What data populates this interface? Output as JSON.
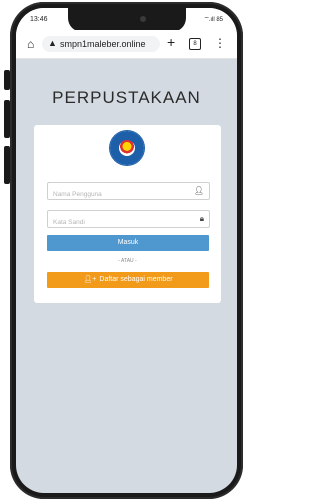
{
  "status": {
    "time": "13:46",
    "right": "Ⲻ.ıll 85"
  },
  "browser": {
    "url": "smpn1maleber.online",
    "tab_count": "8"
  },
  "page": {
    "title": "PERPUSTAKAAN",
    "username_placeholder": "Nama Pengguna",
    "password_placeholder": "Kata Sandi",
    "login_label": "Masuk",
    "or_label": "- ATAU -",
    "register_label": "Daftar sebagai member"
  },
  "colors": {
    "login": "#4f97cf",
    "register": "#f29a1a",
    "background": "#d4dae2"
  }
}
